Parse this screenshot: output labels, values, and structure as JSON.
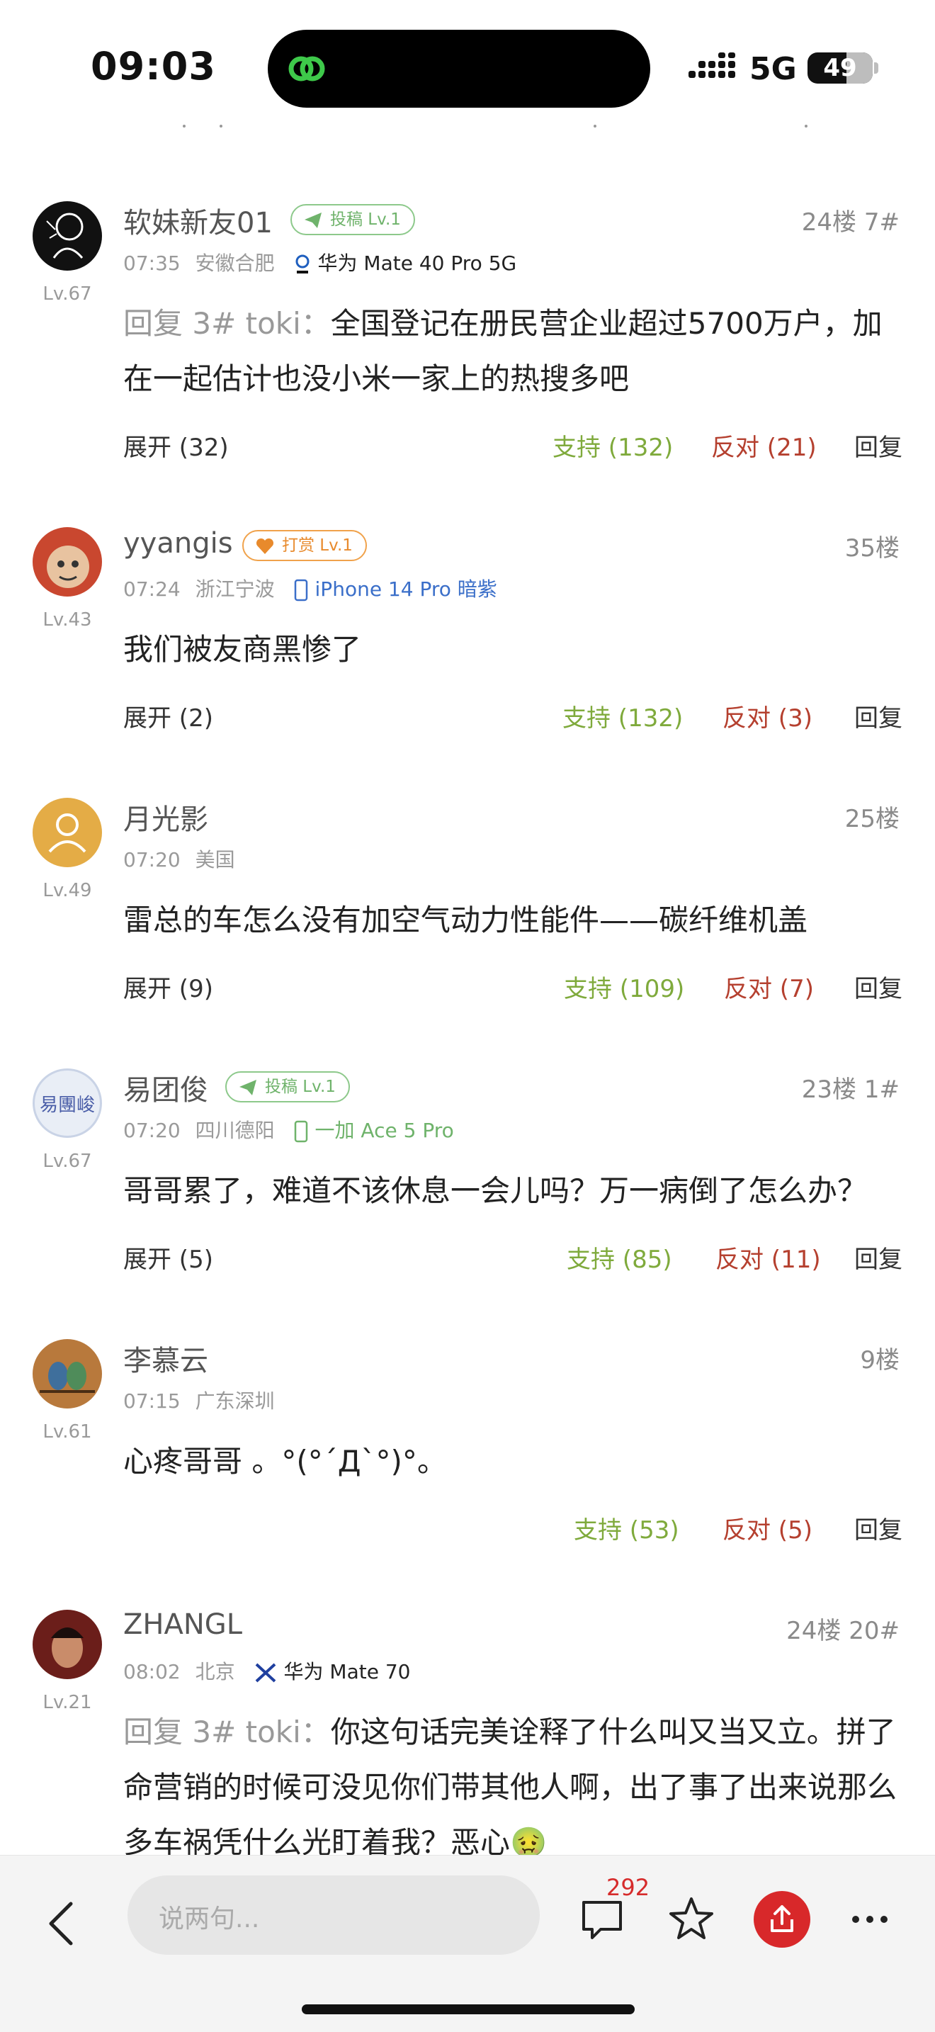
{
  "status_bar": {
    "time": "09:03",
    "network": "5G",
    "battery": "49"
  },
  "comments": [
    {
      "username": "软妹新友01",
      "badge": "投稿 Lv.1",
      "floor": "24楼 7#",
      "time": "07:35",
      "location": "安徽合肥",
      "device": "华为 Mate 40 Pro 5G",
      "level": "Lv.67",
      "reply_prefix": "回复 3# toki：",
      "text": "全国登记在册民营企业超过5700万户，加在一起估计也没小米一家上的热搜多吧",
      "expand": "展开 (32)",
      "support": "支持 (132)",
      "oppose": "反对 (21)",
      "reply": "回复"
    },
    {
      "username": "yyangis",
      "badge": "打赏 Lv.1",
      "floor": "35楼",
      "time": "07:24",
      "location": "浙江宁波",
      "device": "iPhone 14 Pro 暗紫",
      "level": "Lv.43",
      "text": "我们被友商黑惨了",
      "expand": "展开 (2)",
      "support": "支持 (132)",
      "oppose": "反对 (3)",
      "reply": "回复"
    },
    {
      "username": "月光影",
      "floor": "25楼",
      "time": "07:20",
      "location": "美国",
      "level": "Lv.49",
      "text": "雷总的车怎么没有加空气动力性能件——碳纤维机盖",
      "expand": "展开 (9)",
      "support": "支持 (109)",
      "oppose": "反对 (7)",
      "reply": "回复"
    },
    {
      "username": "易团俊",
      "badge": "投稿 Lv.1",
      "floor": "23楼 1#",
      "time": "07:20",
      "location": "四川德阳",
      "device": "一加 Ace 5 Pro",
      "level": "Lv.67",
      "avatar_text": "易團峻",
      "text": "哥哥累了，难道不该休息一会儿吗？万一病倒了怎么办？",
      "expand": "展开 (5)",
      "support": "支持 (85)",
      "oppose": "反对 (11)",
      "reply": "回复"
    },
    {
      "username": "李慕云",
      "floor": "9楼",
      "time": "07:15",
      "location": "广东深圳",
      "level": "Lv.61",
      "text": "心疼哥哥 。°(°ˊДˋ°)°。",
      "support": "支持 (53)",
      "oppose": "反对 (5)",
      "reply": "回复"
    },
    {
      "username": "ZHANGL",
      "floor": "24楼 20#",
      "time": "08:02",
      "location": "北京",
      "device": "华为 Mate 70",
      "level": "Lv.21",
      "reply_prefix": "回复 3# toki：",
      "text": "你这句话完美诠释了什么叫又当又立。拼了命营销的时候可没见你们带其他人啊，出了事了出来说那么多车祸凭什么光盯着我？恶心🤢"
    }
  ],
  "bottom_bar": {
    "input_placeholder": "说两句...",
    "comment_count": "292"
  },
  "colors": {
    "support": "#7faa3c",
    "oppose": "#b5402f",
    "badge_green": "#6fb36b",
    "badge_orange": "#e88a2c",
    "share_red": "#d8282a",
    "device_blue": "#3b6fc9",
    "device_green": "#6fb36b"
  }
}
